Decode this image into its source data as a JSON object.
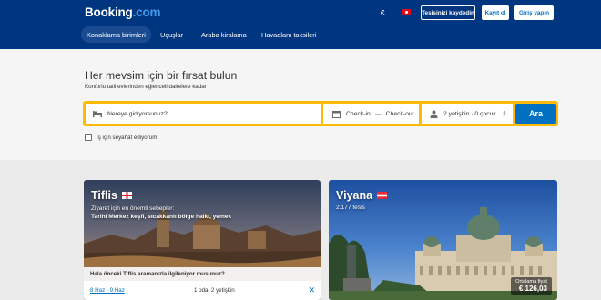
{
  "header": {
    "logo_main": "Booking",
    "logo_dot": ".com",
    "currency": "€",
    "list_property": "Tesisinizi kaydedin",
    "register": "Kayıt ol",
    "sign_in": "Giriş yapın"
  },
  "nav": [
    {
      "label": "Konaklama birimleri",
      "active": true
    },
    {
      "label": "Uçuşlar",
      "active": false
    },
    {
      "label": "Araba kiralama",
      "active": false
    },
    {
      "label": "Havaalanı taksileri",
      "active": false
    }
  ],
  "hero": {
    "title": "Her mevsim için bir fırsat bulun",
    "subtitle": "Konforlu tatil evlerinden eğlenceli dairelere kadar"
  },
  "search": {
    "destination_placeholder": "Nereye gidiyorsunuz?",
    "checkin": "Check-in",
    "dash": "—",
    "checkout": "Check-out",
    "guests": "2 yetişkin · 0 çocuk",
    "button": "Ara",
    "business_label": "İş için seyahat ediyorum"
  },
  "cards": [
    {
      "city": "Tiflis",
      "line1": "Ziyaret için en önemli sebepler:",
      "line2": "Tarihi Merkez keşfi, sıcakkanlı bölge halkı, yemek",
      "resume_text": "Hala önceki Tiflis aramanızla ilgileniyor musunuz?",
      "dates": "8 Haz - 9 Haz",
      "room_info": "1 oda, 2 yetişkin",
      "close": "✕"
    },
    {
      "city": "Viyana",
      "properties": "2.177 tesis",
      "avg_price_label": "Ortalama fiyat",
      "avg_price": "€ 126,03"
    }
  ],
  "colors": {
    "brand_blue": "#003580",
    "accent_blue": "#0071c2",
    "search_yellow": "#febb02"
  }
}
